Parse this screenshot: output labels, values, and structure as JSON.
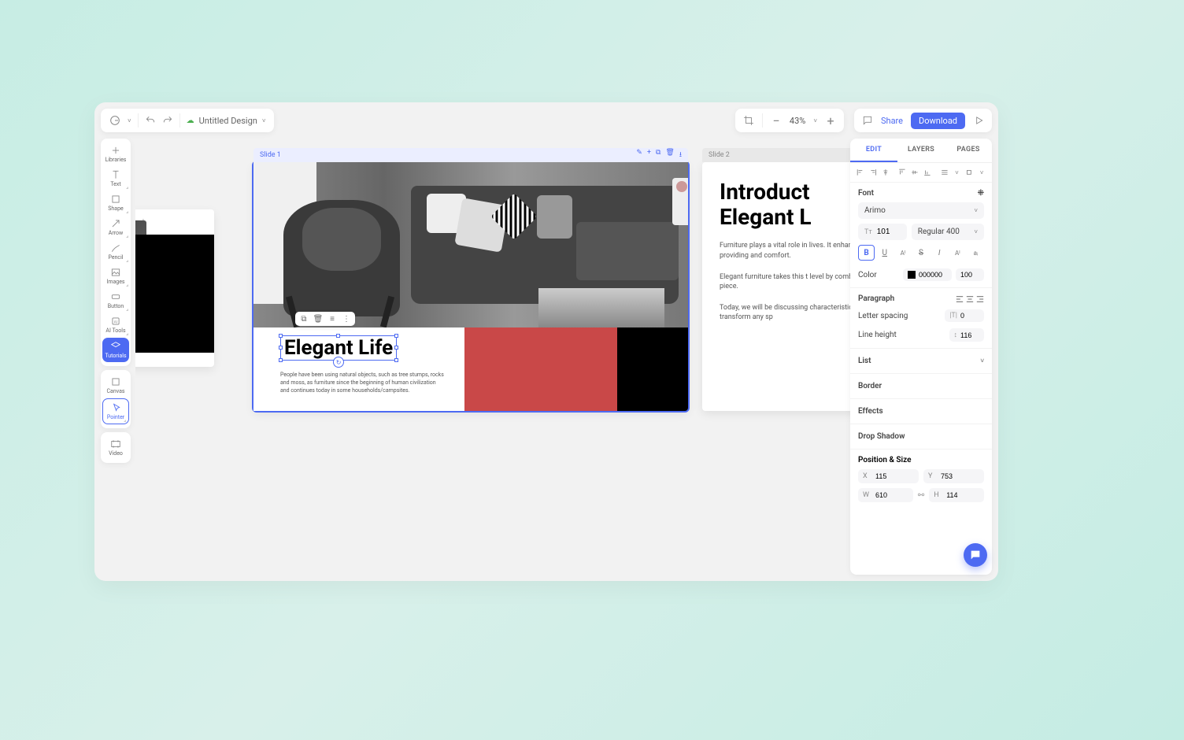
{
  "header": {
    "design_name": "Untitled Design",
    "zoom": "43%",
    "share": "Share",
    "download": "Download"
  },
  "tools": [
    {
      "id": "libraries",
      "label": "Libraries"
    },
    {
      "id": "text",
      "label": "Text"
    },
    {
      "id": "shape",
      "label": "Shape"
    },
    {
      "id": "arrow",
      "label": "Arrow"
    },
    {
      "id": "pencil",
      "label": "Pencil"
    },
    {
      "id": "images",
      "label": "Images"
    },
    {
      "id": "button",
      "label": "Button"
    },
    {
      "id": "ai-tools",
      "label": "AI Tools"
    },
    {
      "id": "tutorials",
      "label": "Tutorials"
    },
    {
      "id": "canvas",
      "label": "Canvas"
    },
    {
      "id": "pointer",
      "label": "Pointer"
    },
    {
      "id": "video",
      "label": "Video"
    }
  ],
  "slides": {
    "slide1": {
      "title": "Slide 1"
    },
    "slide2": {
      "title": "Slide 2"
    },
    "main_title": "Elegant Life",
    "main_sub": "People have been using natural objects, such as tree stumps, rocks and moss, as furniture since the beginning of human civilization and continues today in some households/campsites.",
    "s2_title_l1": "Introduct",
    "s2_title_l2": "Elegant L",
    "s2_p1": "Furniture plays a vital role in lives. It enhances the aesthe any space while providing and comfort.",
    "s2_p2": "Elegant furniture takes this t level by combining style, co functionality in one piece.",
    "s2_p3": "Today, we will be discussing characteristics of elegant fu how it can transform any sp"
  },
  "panel": {
    "tabs": {
      "edit": "EDIT",
      "layers": "LAYERS",
      "pages": "PAGES"
    },
    "font_section": "Font",
    "font_family": "Arimo",
    "font_size": "101",
    "font_weight": "Regular 400",
    "color_label": "Color",
    "color_hex": "000000",
    "color_opacity": "100",
    "paragraph": "Paragraph",
    "letter_spacing_label": "Letter spacing",
    "letter_spacing_value": "0",
    "line_height_label": "Line height",
    "line_height_value": "116",
    "list": "List",
    "border": "Border",
    "effects": "Effects",
    "drop_shadow": "Drop Shadow",
    "pos_size": "Position & Size",
    "x": "115",
    "y": "753",
    "w": "610",
    "h": "114"
  }
}
